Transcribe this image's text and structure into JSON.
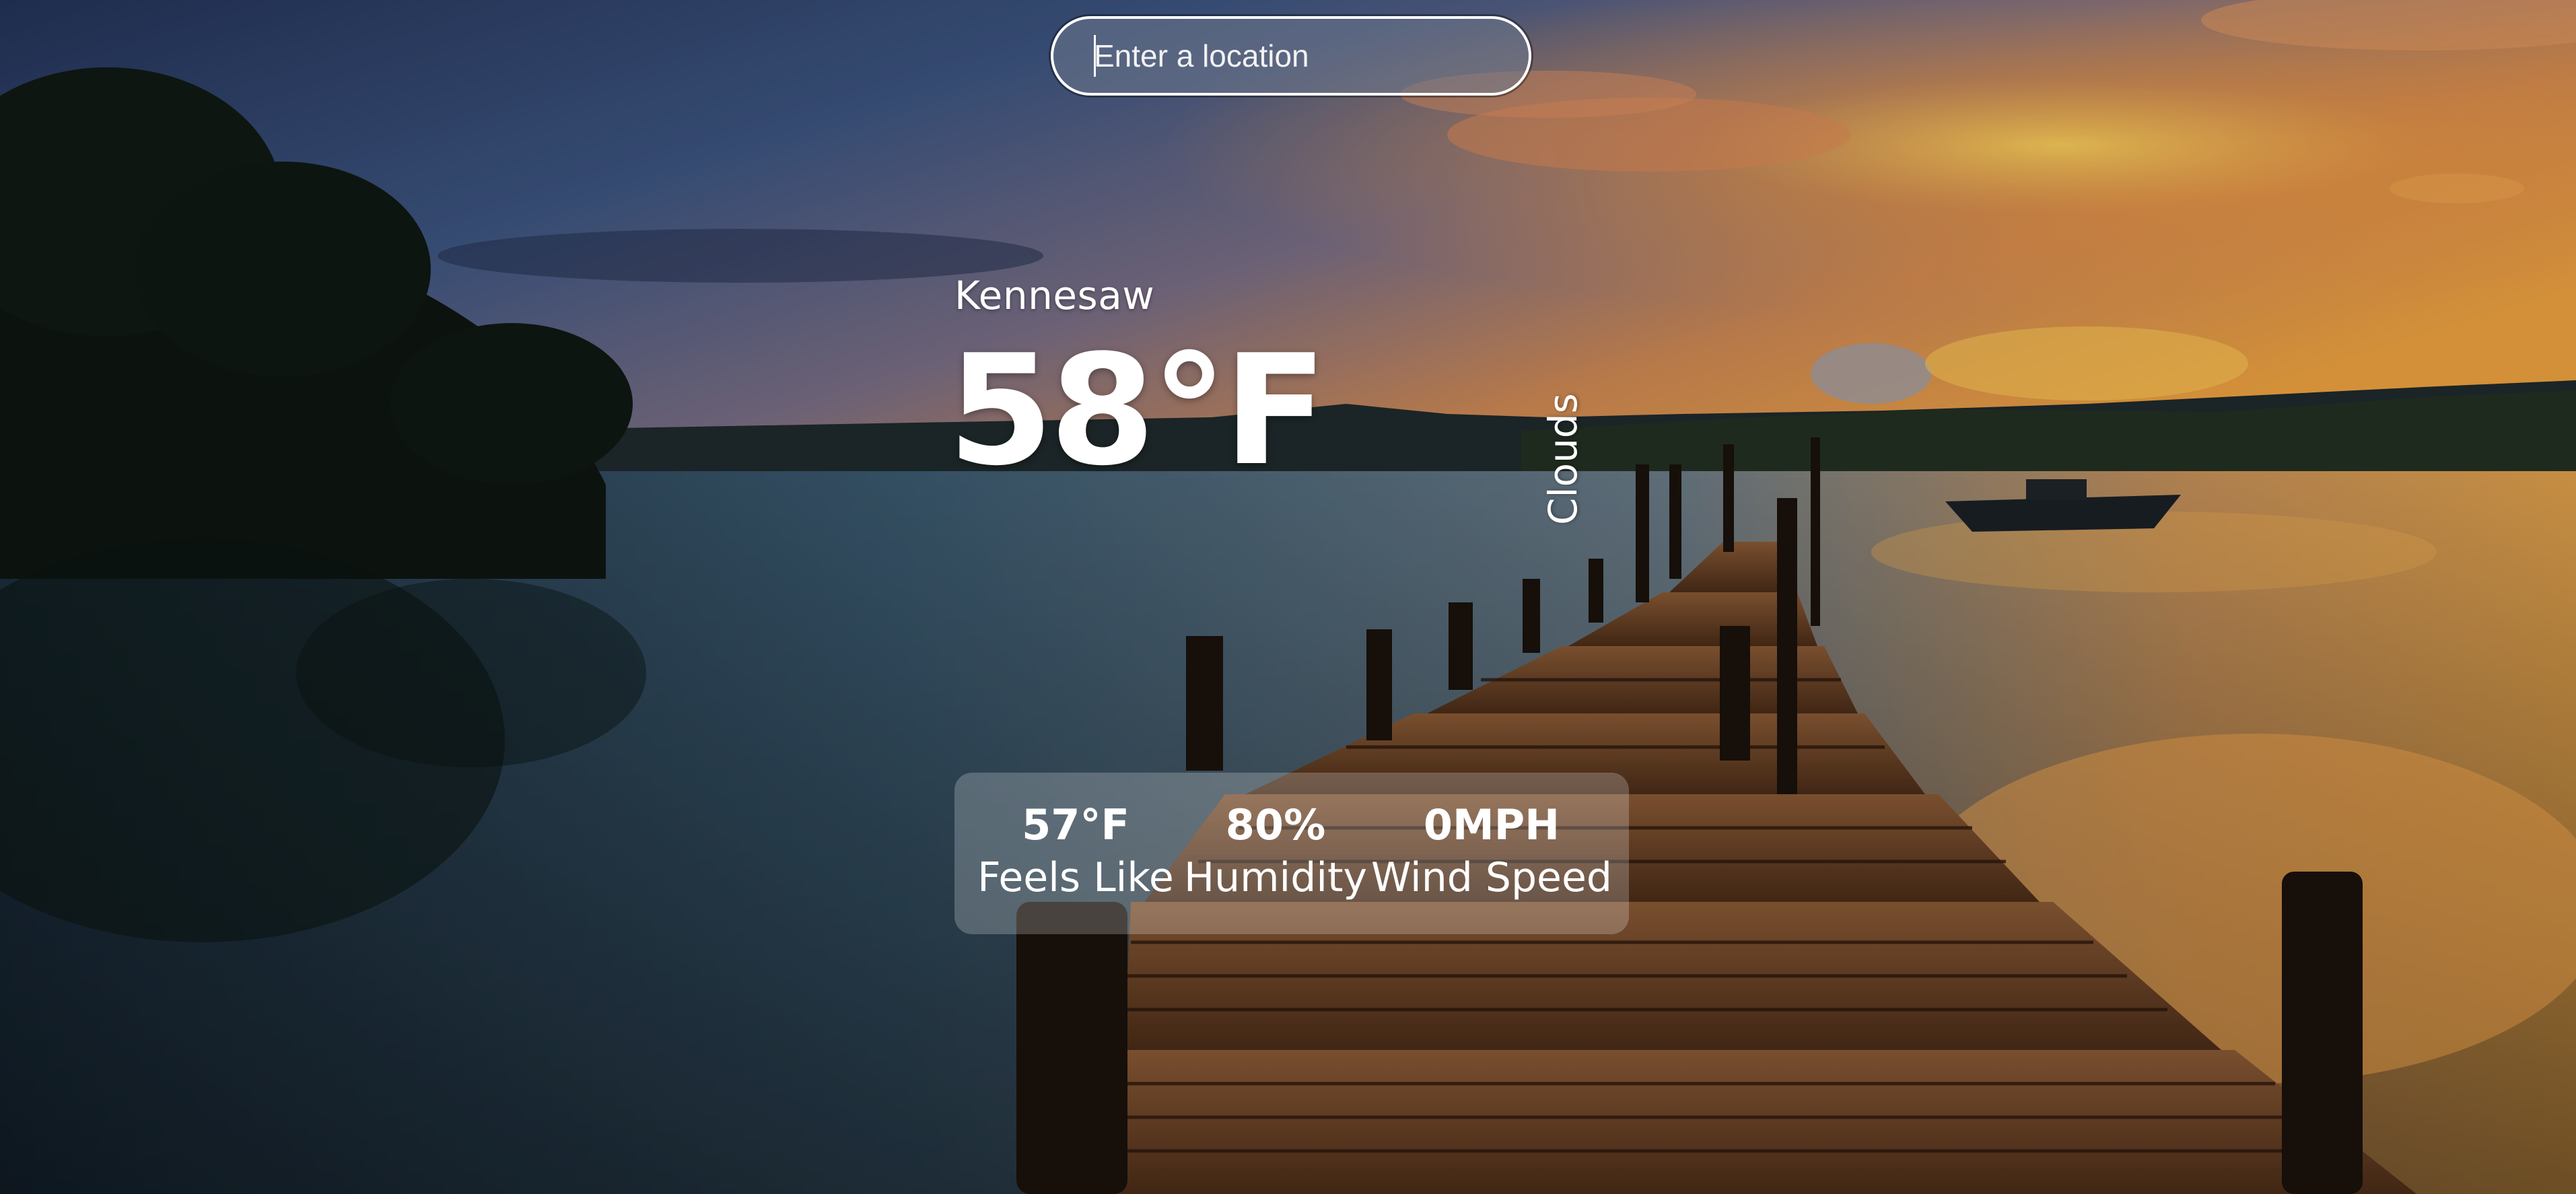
{
  "search": {
    "placeholder": "Enter a location",
    "value": ""
  },
  "weather": {
    "city": "Kennesaw",
    "temperature": "58°F",
    "condition": "Clouds"
  },
  "stats": {
    "feels_like": {
      "value": "57°F",
      "label": "Feels Like"
    },
    "humidity": {
      "value": "80%",
      "label": "Humidity"
    },
    "wind_speed": {
      "value": "0MPH",
      "label": "Wind Speed"
    }
  },
  "background": {
    "scene": "sunset-lake-pier-photo",
    "colors": {
      "sky_top": "#2c3f6e",
      "sky_glow": "#f0a040",
      "water": "#3f5f78",
      "pier_wood": "#6a4128"
    }
  }
}
